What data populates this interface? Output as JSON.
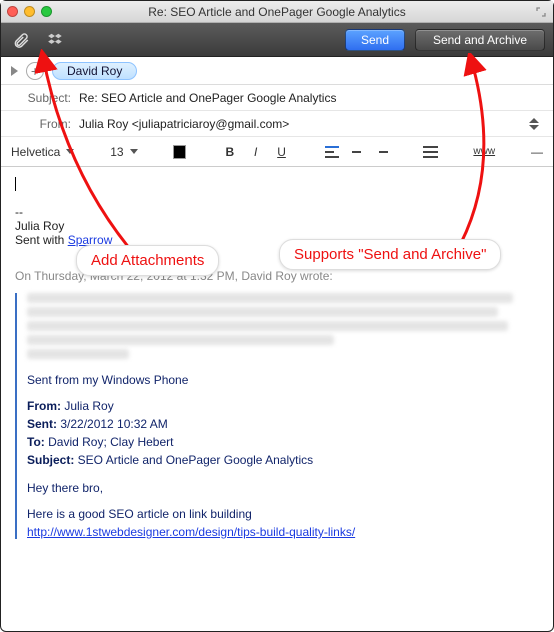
{
  "window": {
    "title": "Re: SEO Article and OnePager Google Analytics"
  },
  "toolbar": {
    "send_label": "Send",
    "send_archive_label": "Send and Archive"
  },
  "recipient": {
    "name": "David Roy"
  },
  "fields": {
    "subject_label": "Subject:",
    "subject_value": "Re: SEO Article and OnePager Google Analytics",
    "from_label": "From:",
    "from_value": "Julia Roy <juliapatriciaroy@gmail.com>"
  },
  "format": {
    "font_name": "Helvetica",
    "font_size": "13",
    "www_label": "www"
  },
  "signature": {
    "dash": "--",
    "name": "Julia Roy",
    "sent_with_prefix": "Sent with ",
    "sent_with_app": "Sparrow"
  },
  "quote": {
    "intro": "On Thursday, March 22, 2012 at 1:32 PM, David Roy wrote:",
    "sent_from": "Sent from my Windows Phone",
    "hdr_from_label": "From:",
    "hdr_from_value": " Julia Roy",
    "hdr_sent_label": "Sent:",
    "hdr_sent_value": " 3/22/2012 10:32 AM",
    "hdr_to_label": "To:",
    "hdr_to_value": " David Roy; Clay Hebert",
    "hdr_subject_label": "Subject:",
    "hdr_subject_value": " SEO Article and OnePager Google Analytics",
    "greeting": "Hey there bro,",
    "body_line": "Here is a good SEO article on link building",
    "link": "http://www.1stwebdesigner.com/design/tips-build-quality-links/"
  },
  "callouts": {
    "add_attachments": "Add Attachments",
    "send_archive": "Supports \"Send and Archive\""
  }
}
